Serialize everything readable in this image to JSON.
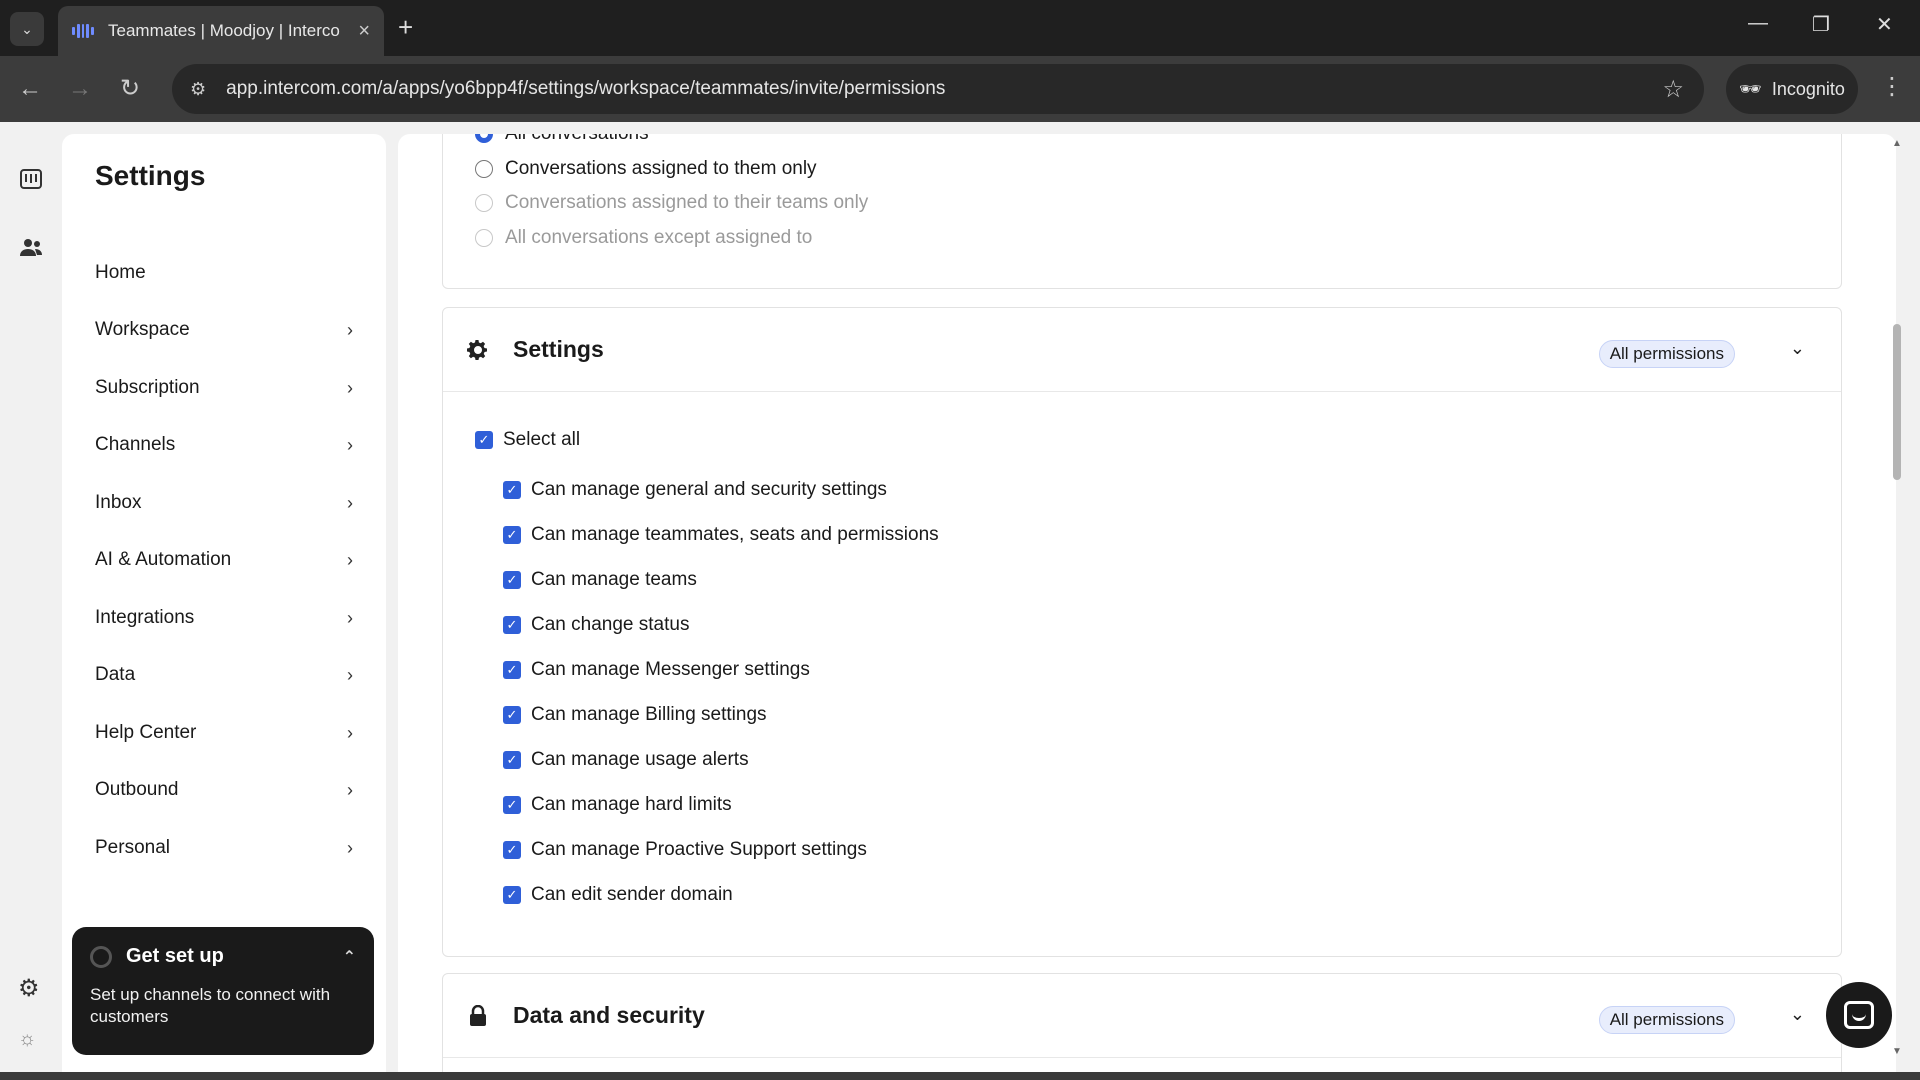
{
  "browser": {
    "tab_title": "Teammates | Moodjoy | Interco",
    "url": "app.intercom.com/a/apps/yo6bpp4f/settings/workspace/teammates/invite/permissions",
    "incognito_label": "Incognito"
  },
  "sidebar": {
    "title": "Settings",
    "items": [
      {
        "label": "Home",
        "has_chevron": false
      },
      {
        "label": "Workspace",
        "has_chevron": true
      },
      {
        "label": "Subscription",
        "has_chevron": true
      },
      {
        "label": "Channels",
        "has_chevron": true
      },
      {
        "label": "Inbox",
        "has_chevron": true
      },
      {
        "label": "AI & Automation",
        "has_chevron": true
      },
      {
        "label": "Integrations",
        "has_chevron": true
      },
      {
        "label": "Data",
        "has_chevron": true
      },
      {
        "label": "Help Center",
        "has_chevron": true
      },
      {
        "label": "Outbound",
        "has_chevron": true
      },
      {
        "label": "Personal",
        "has_chevron": true
      }
    ]
  },
  "setup_card": {
    "title": "Get set up",
    "text": "Set up channels to connect with customers"
  },
  "conversations": {
    "options": [
      {
        "label": "All conversations",
        "state": "checked"
      },
      {
        "label": "Conversations assigned to them only",
        "state": "default"
      },
      {
        "label": "Conversations assigned to their teams only",
        "state": "muted"
      },
      {
        "label": "All conversations except assigned to",
        "state": "muted"
      }
    ]
  },
  "settings_section": {
    "title": "Settings",
    "badge": "All permissions",
    "select_all": "Select all",
    "permissions": [
      "Can manage general and security settings",
      "Can manage teammates, seats and permissions",
      "Can manage teams",
      "Can change status",
      "Can manage Messenger settings",
      "Can manage Billing settings",
      "Can manage usage alerts",
      "Can manage hard limits",
      "Can manage Proactive Support settings",
      "Can edit sender domain"
    ]
  },
  "data_security_section": {
    "title": "Data and security",
    "badge": "All permissions"
  },
  "colors": {
    "accent": "#2f5fd8",
    "badge_bg": "#e8edfc"
  }
}
